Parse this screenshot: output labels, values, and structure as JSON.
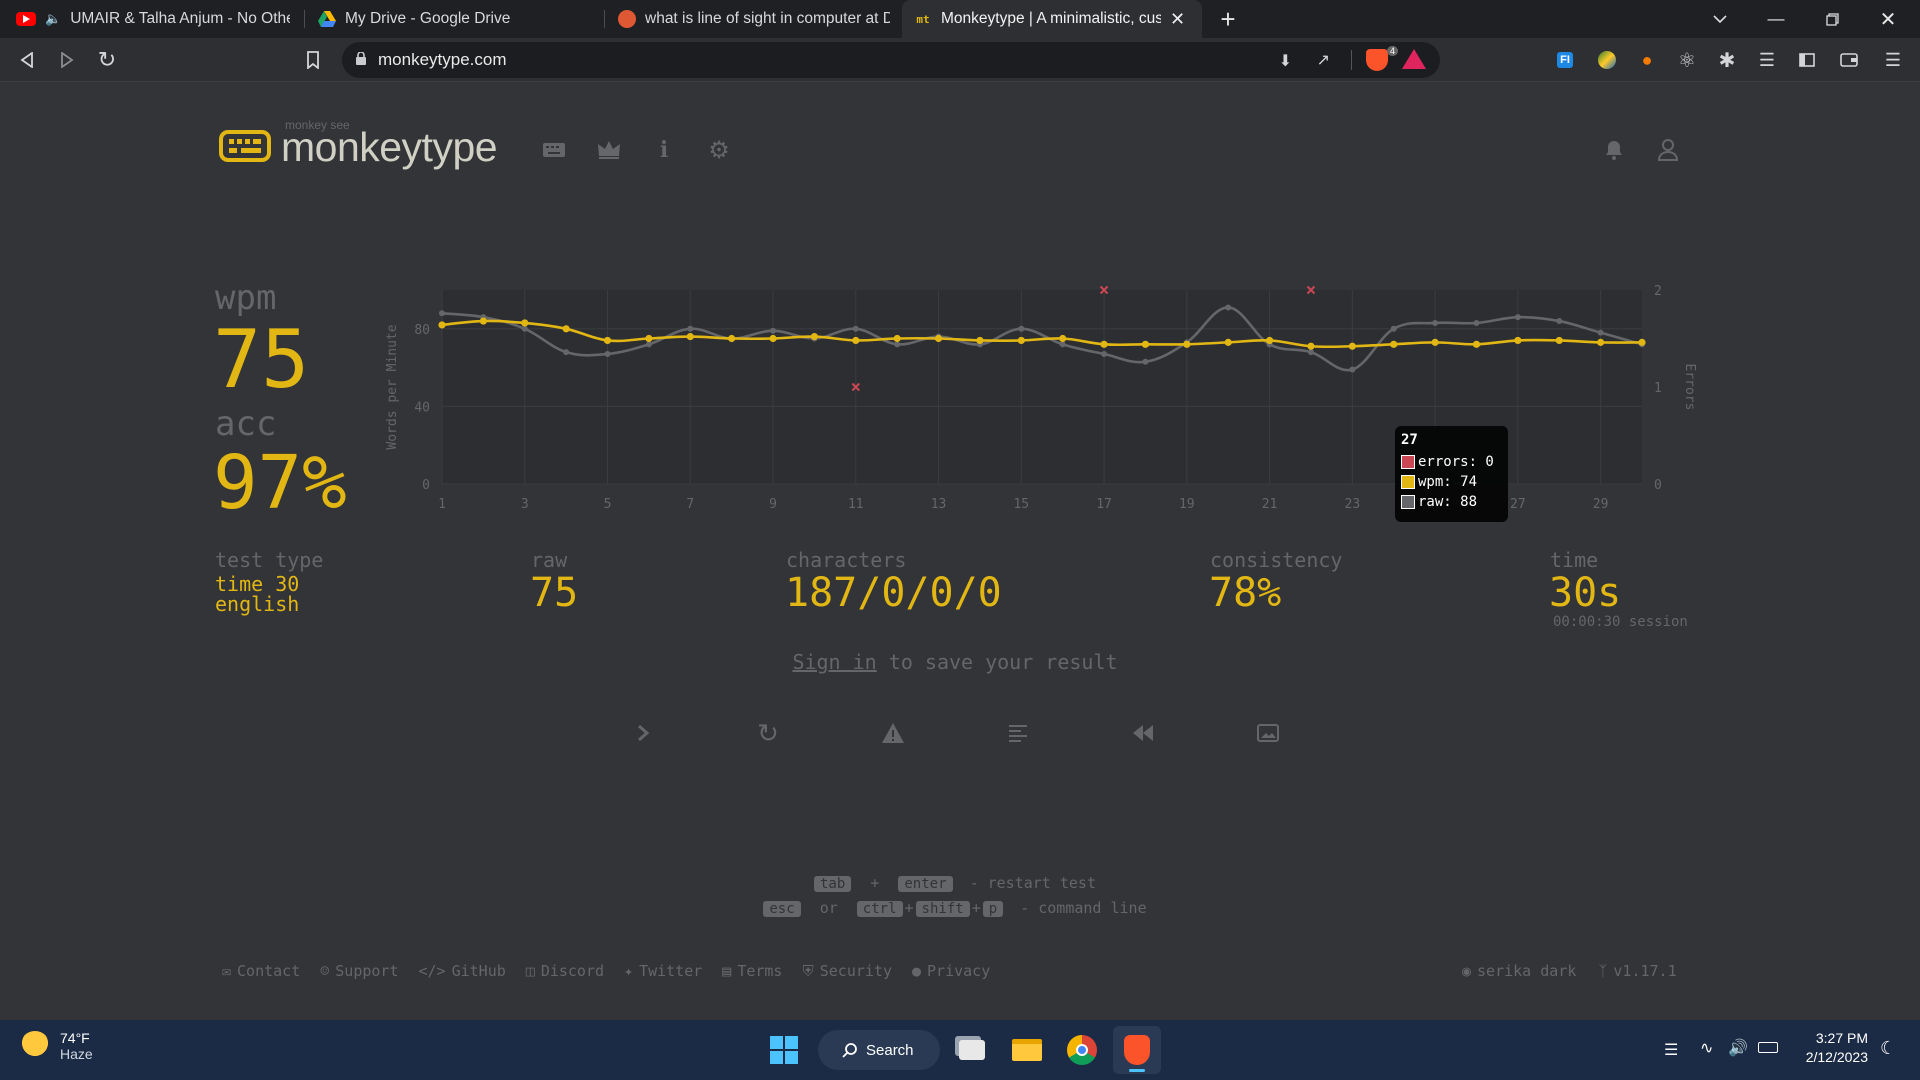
{
  "browser": {
    "tabs": [
      {
        "label": "UMAIR & Talha Anjum - No Other",
        "icon": "youtube-icon",
        "color": "#ff0000"
      },
      {
        "label": "My Drive - Google Drive",
        "icon": "google-drive-icon",
        "color": "#1fa463"
      },
      {
        "label": "what is line of sight in computer at Du",
        "icon": "duckduckgo-icon",
        "color": "#de5833"
      },
      {
        "label": "Monkeytype | A minimalistic, cust",
        "icon": "monkeytype-icon",
        "color": "#e2b714"
      }
    ],
    "new_tab_symbol": "+",
    "url": "monkeytype.com",
    "brave_shield_count": "4"
  },
  "app": {
    "logo_top": "monkey see",
    "logo_text": "monkeytype"
  },
  "results": {
    "wpm_label": "wpm",
    "wpm": "75",
    "acc_label": "acc",
    "acc": "97%",
    "test_type_label": "test type",
    "test_type_line1": "time 30",
    "test_type_line2": "english",
    "raw_label": "raw",
    "raw": "75",
    "characters_label": "characters",
    "characters": "187/0/0/0",
    "consistency_label": "consistency",
    "consistency": "78%",
    "time_label": "time",
    "time": "30s",
    "session": "00:00:30 session",
    "signin_link": "Sign in",
    "signin_rest": " to save your result"
  },
  "chart_data": {
    "type": "line",
    "ylabel": "Words per Minute",
    "y2label": "Errors",
    "x": [
      1,
      2,
      3,
      4,
      5,
      6,
      7,
      8,
      9,
      10,
      11,
      12,
      13,
      14,
      15,
      16,
      17,
      18,
      19,
      20,
      21,
      22,
      23,
      24,
      25,
      26,
      27,
      28,
      29,
      30
    ],
    "xticks": [
      "1",
      "3",
      "5",
      "7",
      "9",
      "11",
      "13",
      "15",
      "17",
      "19",
      "21",
      "23",
      "25",
      "27",
      "29"
    ],
    "ylim": [
      0,
      100
    ],
    "yticks": [
      "0",
      "40",
      "80"
    ],
    "y2lim": [
      0,
      2
    ],
    "y2ticks": [
      "0",
      "1",
      "2"
    ],
    "series": [
      {
        "name": "wpm",
        "color": "#e2b714",
        "values": [
          82,
          84,
          83,
          80,
          74,
          75,
          76,
          75,
          75,
          76,
          74,
          75,
          75,
          74,
          74,
          75,
          72,
          72,
          72,
          73,
          74,
          71,
          71,
          72,
          73,
          72,
          74,
          74,
          73,
          73
        ]
      },
      {
        "name": "raw",
        "color": "#646669",
        "values": [
          88,
          86,
          80,
          68,
          67,
          72,
          80,
          75,
          79,
          75,
          80,
          72,
          76,
          72,
          80,
          72,
          67,
          63,
          73,
          91,
          72,
          68,
          59,
          80,
          83,
          83,
          86,
          84,
          78,
          72
        ]
      },
      {
        "name": "errors",
        "color": "#ca4754",
        "points": [
          [
            11,
            1
          ],
          [
            17,
            2
          ],
          [
            22,
            2
          ]
        ]
      }
    ],
    "tooltip": {
      "title": "27",
      "lines": [
        "errors: 0",
        "wpm: 74",
        "raw: 88"
      ]
    },
    "grid": true
  },
  "actions": [
    {
      "name": "next-test-button",
      "icon": "chevron-right-icon"
    },
    {
      "name": "repeat-test-button",
      "icon": "refresh-icon"
    },
    {
      "name": "practice-words-button",
      "icon": "warning-icon"
    },
    {
      "name": "word-history-button",
      "icon": "lines-icon"
    },
    {
      "name": "replay-button",
      "icon": "rewind-icon"
    },
    {
      "name": "screenshot-button",
      "icon": "image-icon"
    }
  ],
  "hints": {
    "tab": "tab",
    "plus": "+",
    "enter": "enter",
    "restart": "- restart test",
    "esc": "esc",
    "or": "or",
    "ctrl": "ctrl",
    "shift": "shift",
    "p": "p",
    "command": "- command line"
  },
  "footer": {
    "links": [
      "Contact",
      "Support",
      "GitHub",
      "Discord",
      "Twitter",
      "Terms",
      "Security",
      "Privacy"
    ],
    "theme": "serika dark",
    "version": "v1.17.1"
  },
  "taskbar": {
    "weather_temp": "74°F",
    "weather_desc": "Haze",
    "search_label": "Search",
    "time": "3:27 PM",
    "date": "2/12/2023"
  }
}
